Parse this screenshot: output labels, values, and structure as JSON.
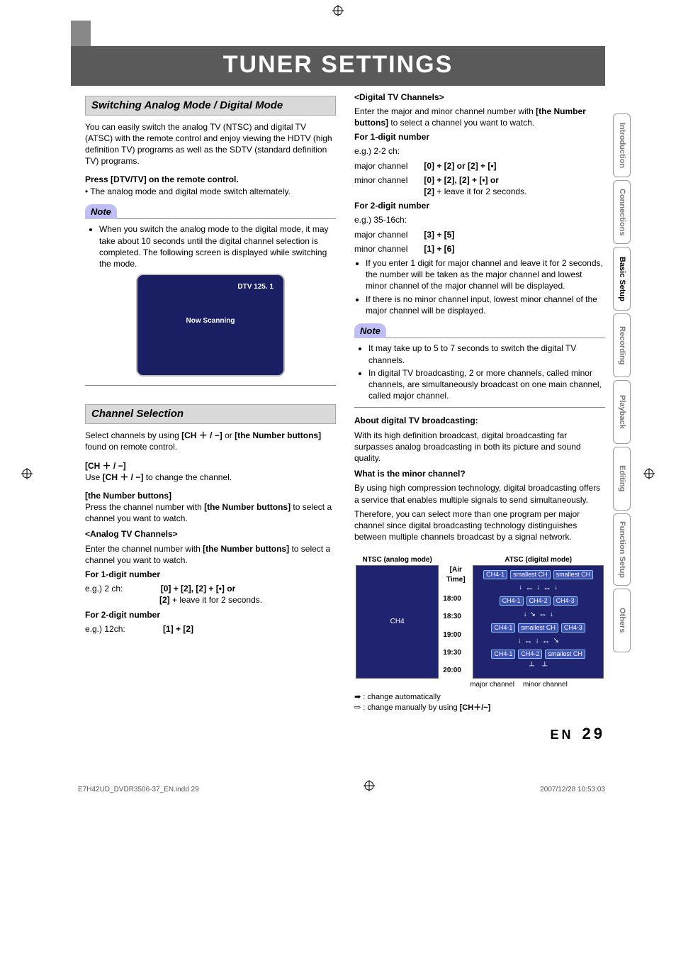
{
  "title": "TUNER SETTINGS",
  "sections": {
    "switching": {
      "heading": "Switching Analog Mode / Digital Mode",
      "intro": "You can easily switch the analog TV (NTSC) and digital TV (ATSC) with the remote control and enjoy viewing the HDTV (high definition TV) programs as well as the SDTV (standard definition TV) programs.",
      "press_label": "Press [DTV/TV] on the remote control.",
      "press_detail": "• The analog mode and digital mode switch alternately.",
      "note_head": "Note",
      "note_body": "When you switch the analog mode to the digital mode, it may take about 10 seconds until the digital channel selection is completed. The following screen is displayed while switching the mode.",
      "tv_channel": "DTV 125. 1",
      "tv_scan": "Now Scanning"
    },
    "channel": {
      "heading": "Channel Selection",
      "intro": "Select channels by using [CH ＋ / −] or [the Number buttons] found on remote control.",
      "ch_label": "[CH ＋ / −]",
      "ch_body": "Use [CH ＋ / −] to change the channel.",
      "nb_label": "[the Number buttons]",
      "nb_body": "Press the channel number with [the Number buttons] to select a channel you want to watch.",
      "analog_head": "<Analog TV Channels>",
      "analog_intro": "Enter the channel number with [the Number buttons] to select a channel you want to watch.",
      "for1": "For 1-digit number",
      "analog_eg1_a": "e.g.) 2 ch:",
      "analog_eg1_b": "[0] + [2], [2] + [•] or",
      "analog_eg1_c": "[2] + leave it for 2 seconds.",
      "for2": "For 2-digit number",
      "analog_eg2_a": "e.g.) 12ch:",
      "analog_eg2_b": "[1] + [2]"
    },
    "digital": {
      "head": "<Digital TV Channels>",
      "intro1": "Enter the major and minor channel number with ",
      "intro1b": "[the Number buttons]",
      "intro1c": " to select a channel you want to watch.",
      "for1": "For 1-digit number",
      "eg_label": "e.g.) 2-2 ch:",
      "major": "major channel",
      "major_v": "[0] + [2] or [2] + [•]",
      "minor": "minor channel",
      "minor_v1": "[0] + [2], [2] + [•] or",
      "minor_v2": "[2] + leave it for 2 seconds.",
      "for2": "For 2-digit number",
      "eg2_label": "e.g.) 35-16ch:",
      "major2_v": "[3] + [5]",
      "minor2_v": "[1] + [6]",
      "bullet1": "If you enter 1 digit for major channel and leave it for 2 seconds, the number will be taken as the major channel and lowest minor channel of the major channel will be displayed.",
      "bullet2": "If there is no minor channel input, lowest minor channel of the major channel will be displayed.",
      "note_head": "Note",
      "note_b1": "It may take up to 5 to 7 seconds to switch the digital TV channels.",
      "note_b2": "In digital TV broadcasting, 2 or more channels, called minor channels, are simultaneously broadcast on one main channel, called major channel.",
      "about_head": "About digital TV broadcasting:",
      "about_body": "With its high definition broadcast, digital broadcasting far surpasses analog broadcasting in both its picture and sound quality.",
      "minor_head": "What is the minor channel?",
      "minor_body1": "By using high compression technology, digital broadcasting offers a service that enables multiple signals to send simultaneously.",
      "minor_body2": "Therefore, you can select more than one program per major channel since digital broadcasting technology distinguishes between multiple channels broadcast by a signal network."
    },
    "diagram": {
      "ntsc_head": "NTSC (analog mode)",
      "airtime": "[Air Time]",
      "atsc_head": "ATSC (digital mode)",
      "times": [
        "18:00",
        "18:30",
        "19:00",
        "19:30",
        "20:00"
      ],
      "ch4": "CH4",
      "chips": {
        "ch41": "CH4-1",
        "ch42": "CH4-2",
        "ch43": "CH4-3",
        "smallest": "smallest CH"
      },
      "caption_major": "major channel",
      "caption_minor": "minor channel",
      "legend_auto": " : change automatically",
      "legend_manual": " : change manually by using [CH＋/−]"
    }
  },
  "tabs": [
    "Introduction",
    "Connections",
    "Basic Setup",
    "Recording",
    "Playback",
    "Editing",
    "Function Setup",
    "Others"
  ],
  "active_tab_index": 2,
  "footer_left": "E7H42UD_DVDR3506-37_EN.indd   29",
  "footer_right": "2007/12/28   10:53:03",
  "page_lang": "EN",
  "page_num": "29"
}
